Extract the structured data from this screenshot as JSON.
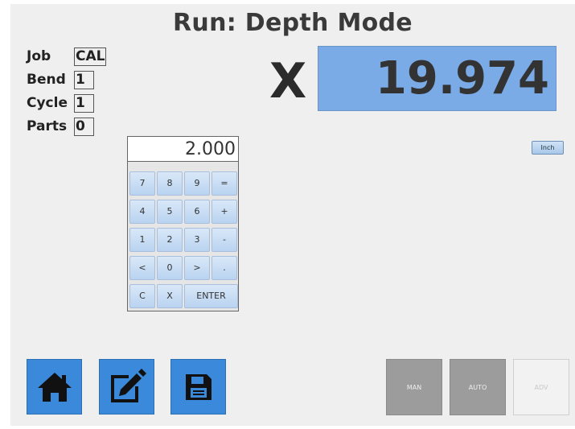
{
  "title": "Run: Depth Mode",
  "info": {
    "job_label": "Job",
    "job_value": "CAL",
    "bend_label": "Bend",
    "bend_value": "1",
    "cycle_label": "Cycle",
    "cycle_value": "1",
    "parts_label": "Parts",
    "parts_value": "0"
  },
  "axis": {
    "letter": "X",
    "position": "19.974"
  },
  "unit_button": "Inch",
  "keypad": {
    "display": "2.000",
    "keys": [
      "7",
      "8",
      "9",
      "=",
      "4",
      "5",
      "6",
      "+",
      "1",
      "2",
      "3",
      "-",
      "<",
      "0",
      ">",
      ".",
      "C",
      "X",
      "ENTER"
    ]
  },
  "tools": {
    "home_icon": "home-icon",
    "edit_icon": "edit-icon",
    "save_icon": "save-icon"
  },
  "modes": {
    "man": "MAN",
    "auto": "AUTO",
    "adv": "ADV"
  },
  "colors": {
    "position_display": "#7aabe6",
    "tool_button": "#3a89da",
    "mode_active": "#9c9c9c"
  }
}
